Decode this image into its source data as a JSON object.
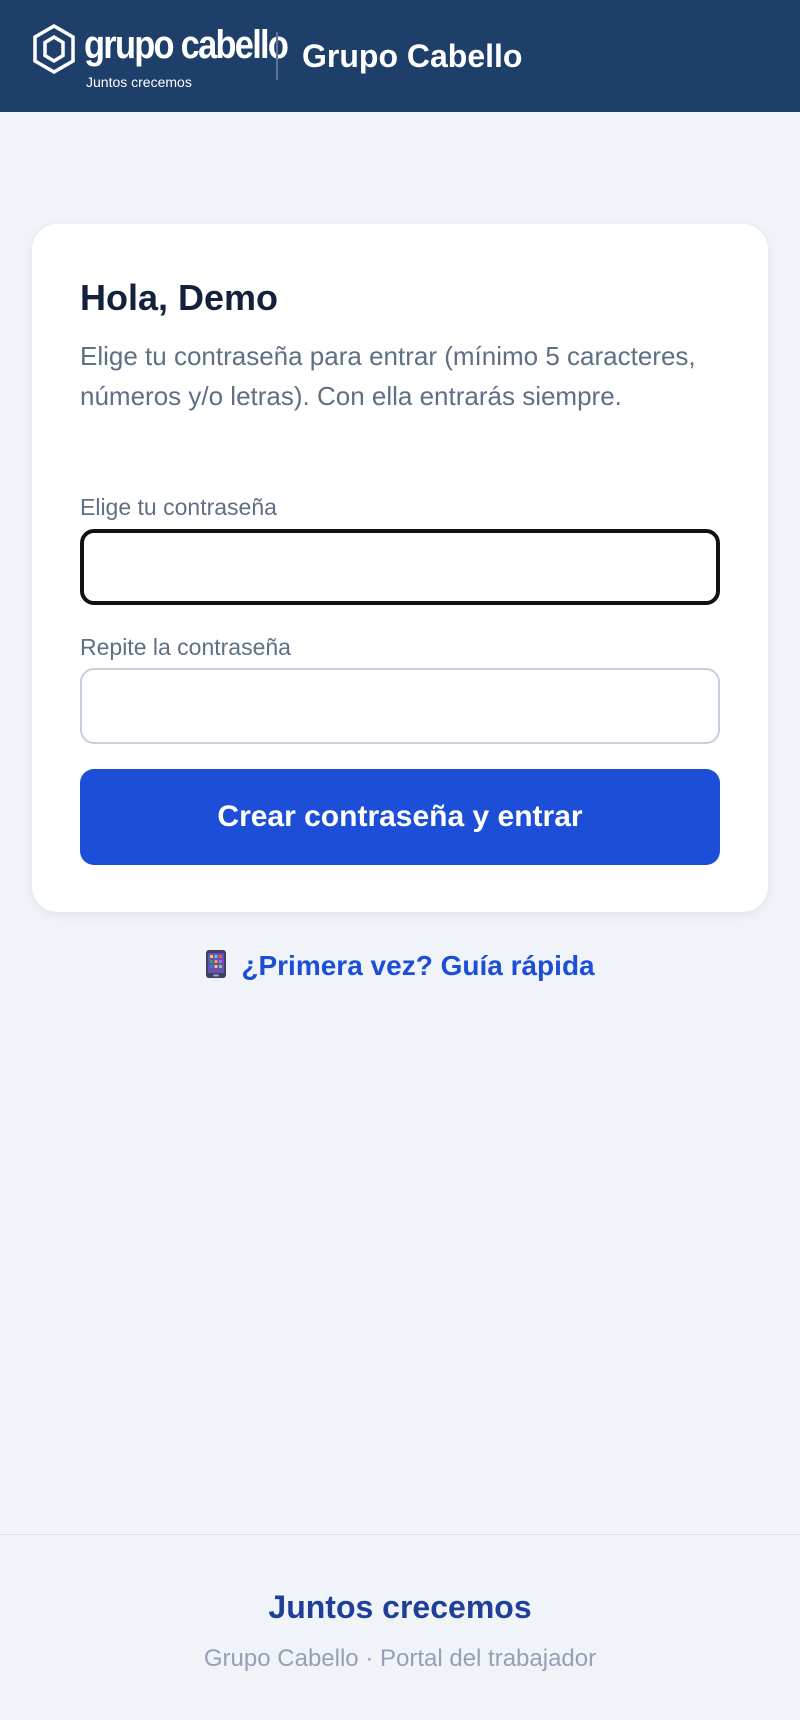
{
  "header": {
    "logo_wordmark": "grupo cabello",
    "logo_tagline": "Juntos crecemos",
    "title": "Grupo Cabello"
  },
  "card": {
    "greeting": "Hola, Demo",
    "intro": "Elige tu contraseña para entrar (mínimo 5 caracteres, números y/o letras). Con ella entrarás siempre.",
    "password_label": "Elige tu contraseña",
    "password_value": "",
    "confirm_label": "Repite la contraseña",
    "confirm_value": "",
    "submit_label": "Crear contraseña y entrar"
  },
  "guide_link": {
    "icon": "mobile-phone-icon",
    "label": "¿Primera vez? Guía rápida"
  },
  "footer": {
    "slogan": "Juntos crecemos",
    "subtitle": "Grupo Cabello · Portal del trabajador"
  },
  "colors": {
    "header_bg": "#1e3f69",
    "page_bg": "#f0f4f9",
    "primary": "#1d4ed8",
    "footer_slogan": "#1f3f99"
  }
}
